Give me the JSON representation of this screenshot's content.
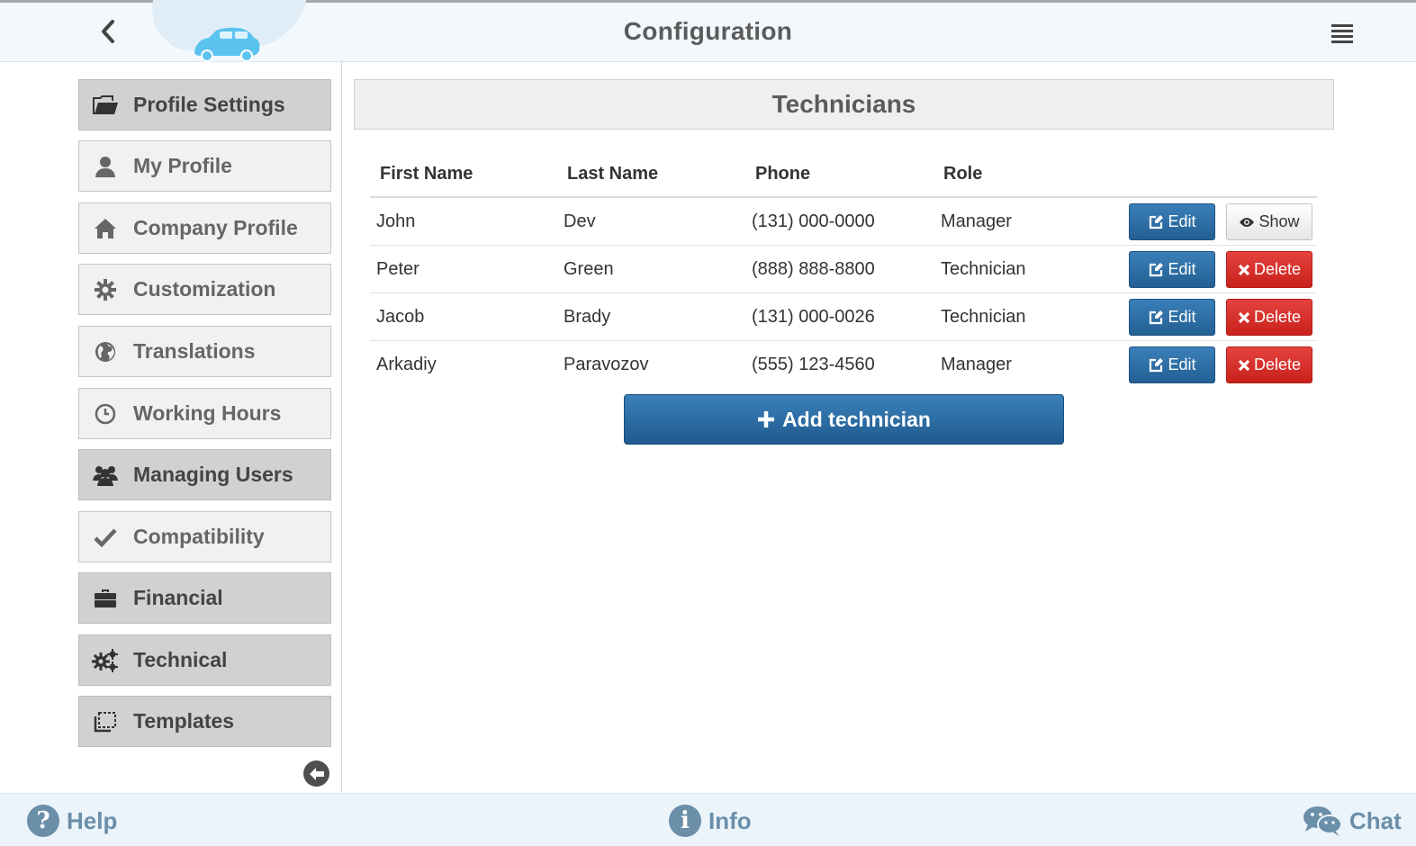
{
  "header": {
    "title": "Configuration",
    "back_icon": "chevron-left-icon",
    "menu_icon": "hamburger-menu-icon",
    "logo": "car-cloud-logo"
  },
  "sidebar": {
    "items": [
      {
        "label": "Profile Settings",
        "icon": "folder-open-icon",
        "type": "group"
      },
      {
        "label": "My Profile",
        "icon": "user-icon",
        "type": "item"
      },
      {
        "label": "Company Profile",
        "icon": "home-icon",
        "type": "item"
      },
      {
        "label": "Customization",
        "icon": "gear-icon",
        "type": "item"
      },
      {
        "label": "Translations",
        "icon": "globe-icon",
        "type": "item"
      },
      {
        "label": "Working Hours",
        "icon": "clock-icon",
        "type": "item"
      },
      {
        "label": "Managing Users",
        "icon": "users-icon",
        "type": "group-active"
      },
      {
        "label": "Compatibility",
        "icon": "check-icon",
        "type": "item"
      },
      {
        "label": "Financial",
        "icon": "briefcase-icon",
        "type": "group"
      },
      {
        "label": "Technical",
        "icon": "gears-icon",
        "type": "group"
      },
      {
        "label": "Templates",
        "icon": "template-icon",
        "type": "group"
      }
    ],
    "collapse_icon": "arrow-left-circle-icon"
  },
  "main": {
    "title": "Technicians",
    "columns": [
      "First Name",
      "Last Name",
      "Phone",
      "Role"
    ],
    "rows": [
      {
        "first": "John",
        "last": "Dev",
        "phone": "(131) 000-0000",
        "role": "Manager",
        "secondary_action": "Show"
      },
      {
        "first": "Peter",
        "last": "Green",
        "phone": "(888) 888-8800",
        "role": "Technician",
        "secondary_action": "Delete"
      },
      {
        "first": "Jacob",
        "last": "Brady",
        "phone": "(131) 000-0026",
        "role": "Technician",
        "secondary_action": "Delete"
      },
      {
        "first": "Arkadiy",
        "last": "Paravozov",
        "phone": "(555) 123-4560",
        "role": "Manager",
        "secondary_action": "Delete"
      }
    ],
    "edit_label": "Edit",
    "show_label": "Show",
    "delete_label": "Delete",
    "add_label": "Add technician"
  },
  "footer": {
    "help": "Help",
    "info": "Info",
    "chat": "Chat"
  },
  "colors": {
    "primary": "#2a6aa3",
    "danger": "#d9302b",
    "footer_text": "#6b8ea9",
    "sidebar_group": "#d1d1d1",
    "sidebar_item": "#f1f1f1"
  }
}
